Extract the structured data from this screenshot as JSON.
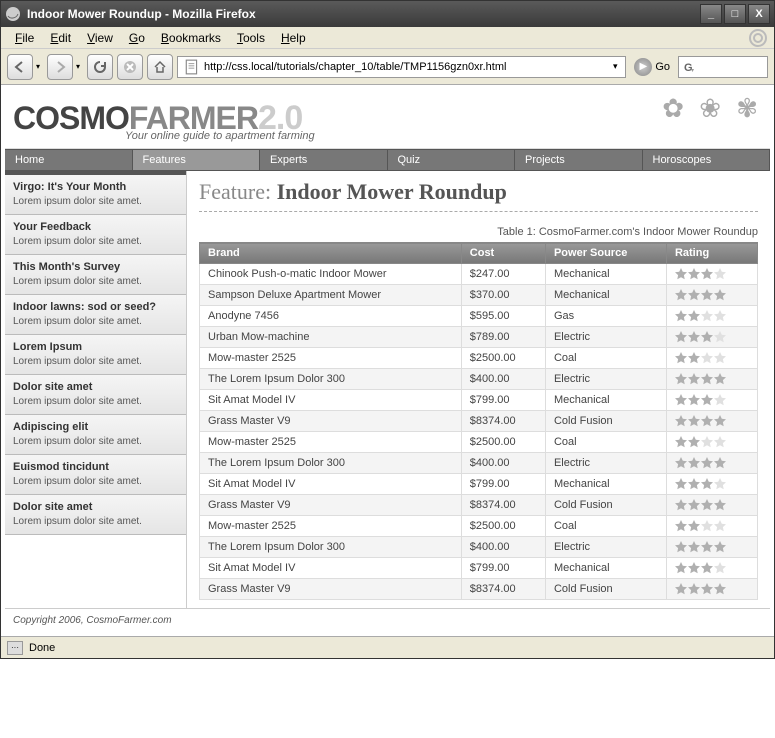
{
  "window": {
    "title": "Indoor Mower Roundup - Mozilla Firefox"
  },
  "menus": [
    "File",
    "Edit",
    "View",
    "Go",
    "Bookmarks",
    "Tools",
    "Help"
  ],
  "url": "http://css.local/tutorials/chapter_10/table/TMP1156gzn0xr.html",
  "go_label": "Go",
  "logo": {
    "part1": "COSMO",
    "part2": "FARMER",
    "ver": "2.0",
    "tagline": "Your online guide to apartment farming"
  },
  "nav": [
    {
      "label": "Home",
      "active": false
    },
    {
      "label": "Features",
      "active": true
    },
    {
      "label": "Experts",
      "active": false
    },
    {
      "label": "Quiz",
      "active": false
    },
    {
      "label": "Projects",
      "active": false
    },
    {
      "label": "Horoscopes",
      "active": false
    }
  ],
  "sidebar": [
    {
      "title": "Virgo: It's Your Month",
      "body": "Lorem ipsum dolor site amet."
    },
    {
      "title": "Your Feedback",
      "body": "Lorem ipsum dolor site amet."
    },
    {
      "title": "This Month's Survey",
      "body": "Lorem ipsum dolor site amet."
    },
    {
      "title": "Indoor lawns: sod or seed?",
      "body": "Lorem ipsum dolor site amet."
    },
    {
      "title": "Lorem Ipsum",
      "body": "Lorem ipsum dolor site amet."
    },
    {
      "title": "Dolor site amet",
      "body": "Lorem ipsum dolor site amet."
    },
    {
      "title": "Adipiscing elit",
      "body": "Lorem ipsum dolor site amet."
    },
    {
      "title": "Euismod tincidunt",
      "body": "Lorem ipsum dolor site amet."
    },
    {
      "title": "Dolor site amet",
      "body": "Lorem ipsum dolor site amet."
    }
  ],
  "feature": {
    "prefix": "Feature: ",
    "name": "Indoor Mower Roundup"
  },
  "caption": "Table 1: CosmoFarmer.com's Indoor Mower Roundup",
  "columns": [
    "Brand",
    "Cost",
    "Power Source",
    "Rating"
  ],
  "rows": [
    {
      "brand": "Chinook Push-o-matic Indoor Mower",
      "cost": "$247.00",
      "power": "Mechanical",
      "rating": 3
    },
    {
      "brand": "Sampson Deluxe Apartment Mower",
      "cost": "$370.00",
      "power": "Mechanical",
      "rating": 4
    },
    {
      "brand": "Anodyne 7456",
      "cost": "$595.00",
      "power": "Gas",
      "rating": 2
    },
    {
      "brand": "Urban Mow-machine",
      "cost": "$789.00",
      "power": "Electric",
      "rating": 3
    },
    {
      "brand": "Mow-master 2525",
      "cost": "$2500.00",
      "power": "Coal",
      "rating": 2
    },
    {
      "brand": "The Lorem Ipsum Dolor 300",
      "cost": "$400.00",
      "power": "Electric",
      "rating": 4
    },
    {
      "brand": "Sit Amat Model IV",
      "cost": "$799.00",
      "power": "Mechanical",
      "rating": 3
    },
    {
      "brand": "Grass Master V9",
      "cost": "$8374.00",
      "power": "Cold Fusion",
      "rating": 4
    },
    {
      "brand": "Mow-master 2525",
      "cost": "$2500.00",
      "power": "Coal",
      "rating": 2
    },
    {
      "brand": "The Lorem Ipsum Dolor 300",
      "cost": "$400.00",
      "power": "Electric",
      "rating": 4
    },
    {
      "brand": "Sit Amat Model IV",
      "cost": "$799.00",
      "power": "Mechanical",
      "rating": 3
    },
    {
      "brand": "Grass Master V9",
      "cost": "$8374.00",
      "power": "Cold Fusion",
      "rating": 4
    },
    {
      "brand": "Mow-master 2525",
      "cost": "$2500.00",
      "power": "Coal",
      "rating": 2
    },
    {
      "brand": "The Lorem Ipsum Dolor 300",
      "cost": "$400.00",
      "power": "Electric",
      "rating": 4
    },
    {
      "brand": "Sit Amat Model IV",
      "cost": "$799.00",
      "power": "Mechanical",
      "rating": 3
    },
    {
      "brand": "Grass Master V9",
      "cost": "$8374.00",
      "power": "Cold Fusion",
      "rating": 4
    }
  ],
  "footer": "Copyright 2006, CosmoFarmer.com",
  "status": "Done",
  "winbtn": {
    "min": "_",
    "max": "□",
    "close": "X"
  }
}
